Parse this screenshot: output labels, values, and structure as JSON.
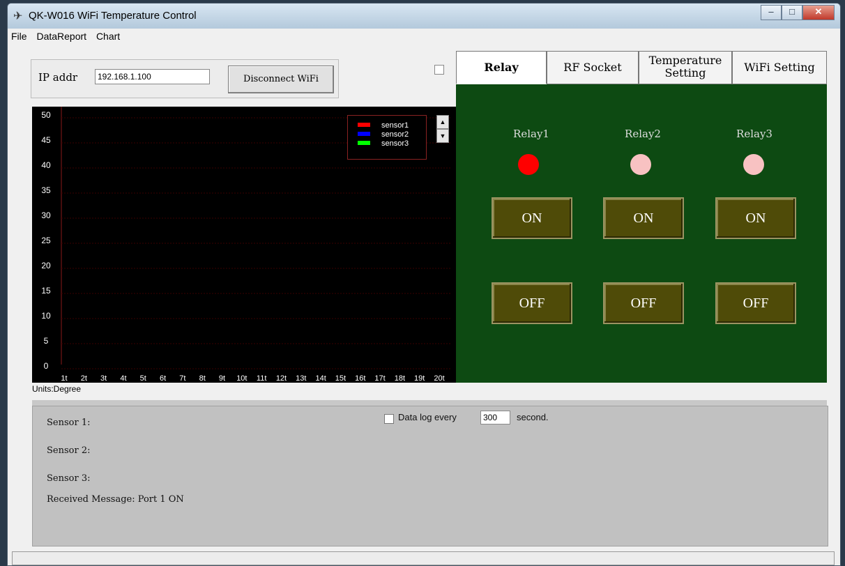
{
  "window": {
    "title": "QK-W016  WiFi Temperature Control"
  },
  "menu": [
    "File",
    "DataReport",
    "Chart"
  ],
  "connection": {
    "ip_label": "IP addr",
    "ip_value": "192.168.1.100",
    "button": "Disconnect WiFi"
  },
  "chart_data": {
    "type": "line",
    "yticks": [
      "50",
      "45",
      "40",
      "35",
      "30",
      "25",
      "20",
      "15",
      "10",
      "5",
      "0"
    ],
    "ylim": [
      0,
      50
    ],
    "xticks": [
      "1t",
      "2t",
      "3t",
      "4t",
      "5t",
      "6t",
      "7t",
      "8t",
      "9t",
      "10t",
      "11t",
      "12t",
      "13t",
      "14t",
      "15t",
      "16t",
      "17t",
      "18t",
      "19t",
      "20t"
    ],
    "series": [
      {
        "name": "sensor1",
        "color": "#ff0000",
        "values": []
      },
      {
        "name": "sensor2",
        "color": "#0000ff",
        "values": []
      },
      {
        "name": "sensor3",
        "color": "#00ff00",
        "values": []
      }
    ],
    "units": "Units:Degree"
  },
  "tabs": [
    "Relay",
    "RF Socket",
    "Temperature Setting",
    "WiFi Setting"
  ],
  "relays": [
    {
      "label": "Relay1",
      "led_color": "#ff0000",
      "on": "ON",
      "off": "OFF"
    },
    {
      "label": "Relay2",
      "led_color": "#f8c2c2",
      "on": "ON",
      "off": "OFF"
    },
    {
      "label": "Relay3",
      "led_color": "#f8c2c2",
      "on": "ON",
      "off": "OFF"
    }
  ],
  "sensors": {
    "s1": "Sensor 1:",
    "s2": "Sensor 2:",
    "s3": "Sensor 3:",
    "received": "Received Message: Port 1 ON"
  },
  "datalog": {
    "label": "Data log every",
    "value": "300",
    "unit": "second."
  }
}
